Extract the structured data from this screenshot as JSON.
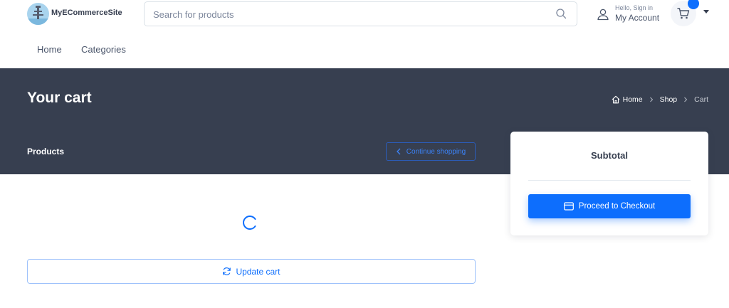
{
  "header": {
    "brand": "MyECommerceSite",
    "search_placeholder": "Search for products",
    "account_greeting": "Hello, Sign in",
    "account_label": "My Account"
  },
  "nav": {
    "items": [
      {
        "label": "Home"
      },
      {
        "label": "Categories"
      }
    ]
  },
  "hero": {
    "title": "Your cart",
    "breadcrumb": [
      {
        "label": "Home"
      },
      {
        "label": "Shop"
      },
      {
        "label": "Cart"
      }
    ],
    "products_label": "Products",
    "continue_label": "Continue shopping"
  },
  "summary": {
    "subtotal_label": "Subtotal",
    "checkout_label": "Proceed to Checkout"
  },
  "cart": {
    "update_label": "Update cart"
  },
  "colors": {
    "accent": "#0d6efd",
    "band": "#373f50",
    "logo_bg": "#a9d4ee"
  },
  "icons": {
    "search": "search-icon",
    "user": "user-icon",
    "cart": "cart-icon",
    "home": "home-icon",
    "chevron": "chevron-right-icon",
    "back": "chevron-left-icon",
    "card": "credit-card-icon",
    "refresh": "refresh-icon",
    "spinner": "loading-spinner-icon"
  }
}
